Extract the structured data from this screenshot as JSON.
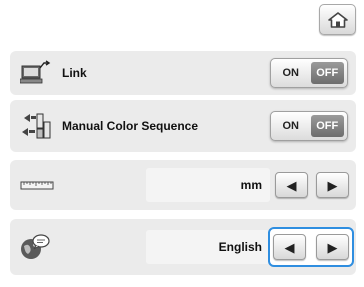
{
  "header": {
    "home_icon": "home-icon"
  },
  "rows": [
    {
      "label": "Link",
      "icon": "link-monitor-icon",
      "on_label": "ON",
      "off_label": "OFF"
    },
    {
      "label": "Manual Color Sequence",
      "icon": "color-sequence-icon",
      "on_label": "ON",
      "off_label": "OFF"
    },
    {
      "label": "",
      "icon": "ruler-icon",
      "value": "mm"
    },
    {
      "label": "",
      "icon": "globe-language-icon",
      "value": "English"
    }
  ],
  "arrows": {
    "left": "◀",
    "right": "▶"
  },
  "colors": {
    "highlight": "#2f8ee0",
    "row_bg": "#ebebeb",
    "off_active": "#7a7a7a"
  }
}
